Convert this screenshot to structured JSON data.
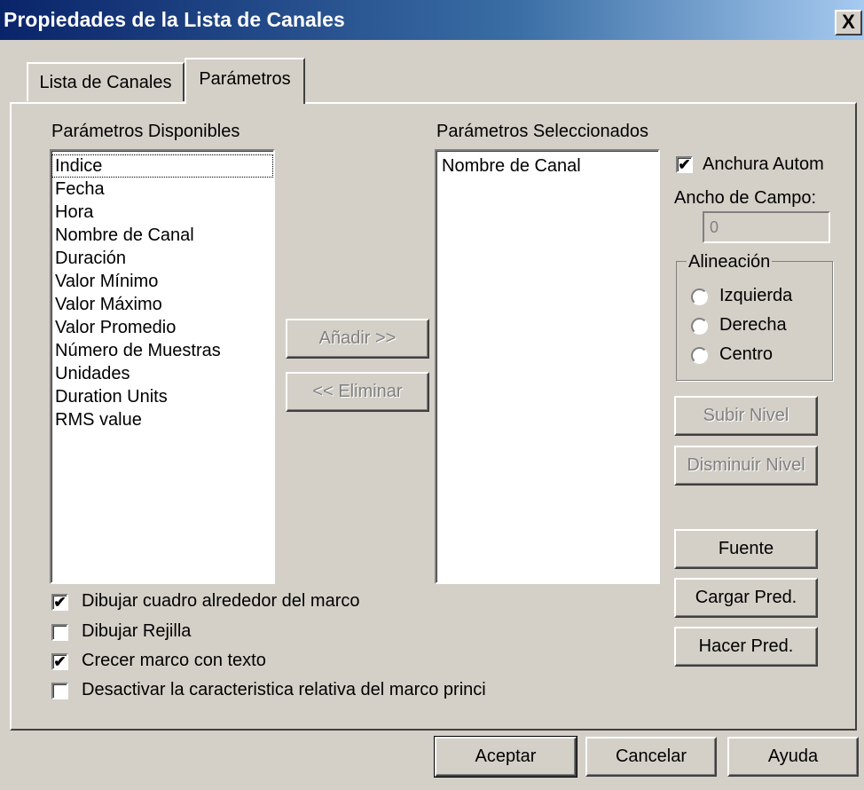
{
  "window": {
    "title": "Propiedades de la Lista de Canales",
    "close_label": "X"
  },
  "tabs": [
    {
      "label": "Lista de Canales",
      "active": false
    },
    {
      "label": "Parámetros",
      "active": true
    }
  ],
  "available": {
    "label": "Parámetros Disponibles",
    "items": [
      "Indice",
      "Fecha",
      "Hora",
      "Nombre de Canal",
      "Duración",
      "Valor Mínimo",
      "Valor Máximo",
      "Valor Promedio",
      "Número de Muestras",
      "Unidades",
      "Duration Units",
      "RMS value"
    ]
  },
  "selected": {
    "label": "Parámetros Seleccionados",
    "items": [
      "Nombre de Canal"
    ]
  },
  "buttons": {
    "add": "Añadir >>",
    "remove": "<< Eliminar",
    "move_up": "Subir Nivel",
    "move_down": "Disminuir Nivel",
    "font": "Fuente",
    "load_default": "Cargar Pred.",
    "make_default": "Hacer Pred."
  },
  "auto_width": {
    "label": "Anchura Autom",
    "checked": true
  },
  "field_width": {
    "label": "Ancho de Campo:",
    "value": "0"
  },
  "alignment": {
    "legend": "Alineación",
    "options": [
      "Izquierda",
      "Derecha",
      "Centro"
    ]
  },
  "options": [
    {
      "label": "Dibujar cuadro alrededor del marco",
      "checked": true
    },
    {
      "label": "Dibujar Rejilla",
      "checked": false
    },
    {
      "label": "Crecer marco con texto",
      "checked": true
    },
    {
      "label": "Desactivar la caracteristica relativa del marco princi",
      "checked": false
    }
  ],
  "footer": {
    "accept": "Aceptar",
    "cancel": "Cancelar",
    "help": "Ayuda"
  },
  "check_mark": "✔"
}
